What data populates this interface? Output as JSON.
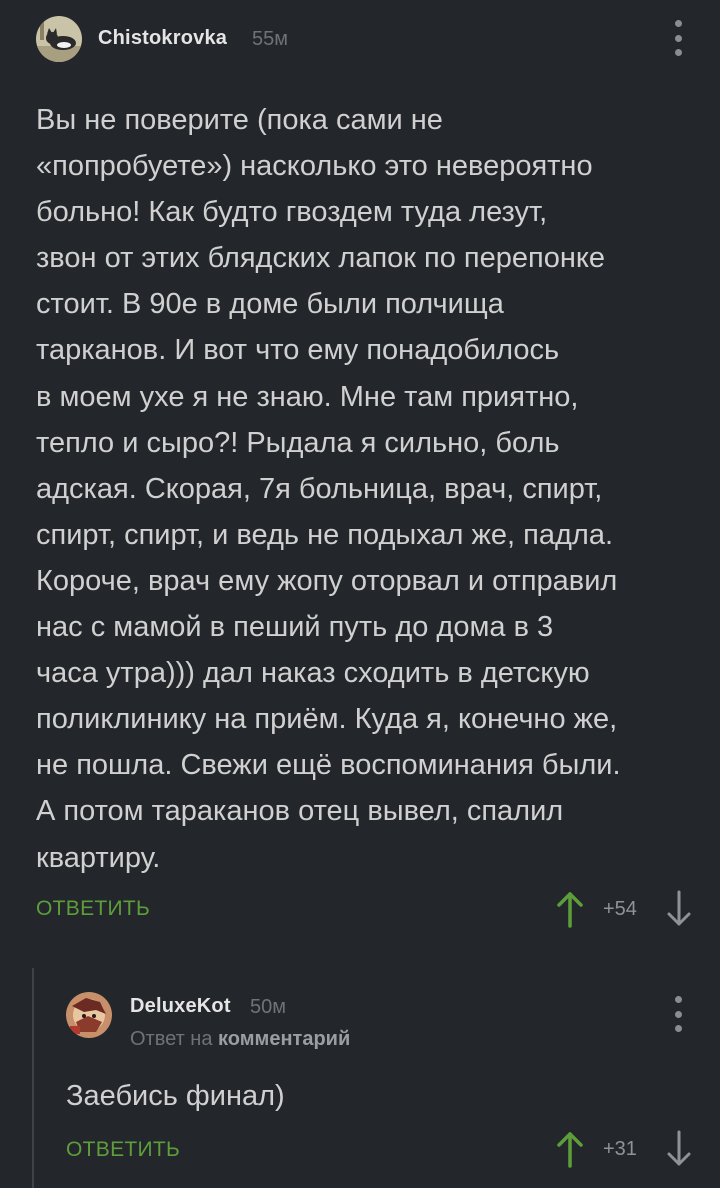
{
  "comments": [
    {
      "username": "Chistokrovka",
      "time": "55м",
      "text": "Вы не поверите (пока сами не\n«попробуете») насколько это невероятно\nбольно! Как будто гвоздем туда лезут,\nзвон от этих блядских лапок по перепонке\nстоит. В 90е в доме были полчища\nтарканов. И вот что ему понадобилось\nв моем ухе я не знаю. Мне там приятно,\nтепло и сыро?! Рыдала я сильно, боль\nадская. Скорая, 7я больница, врач, спирт,\nспирт, спирт, и ведь не подыхал же, падла.\nКороче, врач ему жопу оторвал и отправил\nнас с мамой в пеший путь до дома в 3\nчаса утра))) дал наказ сходить в детскую\nполиклинику на приём. Куда я, конечно же,\nне пошла. Свежи ещё воспоминания были.\nА потом тараканов отец вывел, спалил\nквартиру.",
      "reply_label": "ОТВЕТИТЬ",
      "score": "+54",
      "avatar_icon": "cat-avatar-icon"
    },
    {
      "username": "DeluxeKot",
      "time": "50м",
      "reply_to_prefix": "Ответ на",
      "reply_to_target": "комментарий",
      "text": "Заебись финал)",
      "reply_label": "ОТВЕТИТЬ",
      "score": "+31",
      "avatar_icon": "illustrated-avatar-icon"
    }
  ],
  "colors": {
    "background": "#23262a",
    "accent_green": "#5d9e3a",
    "muted": "#6f7378"
  }
}
